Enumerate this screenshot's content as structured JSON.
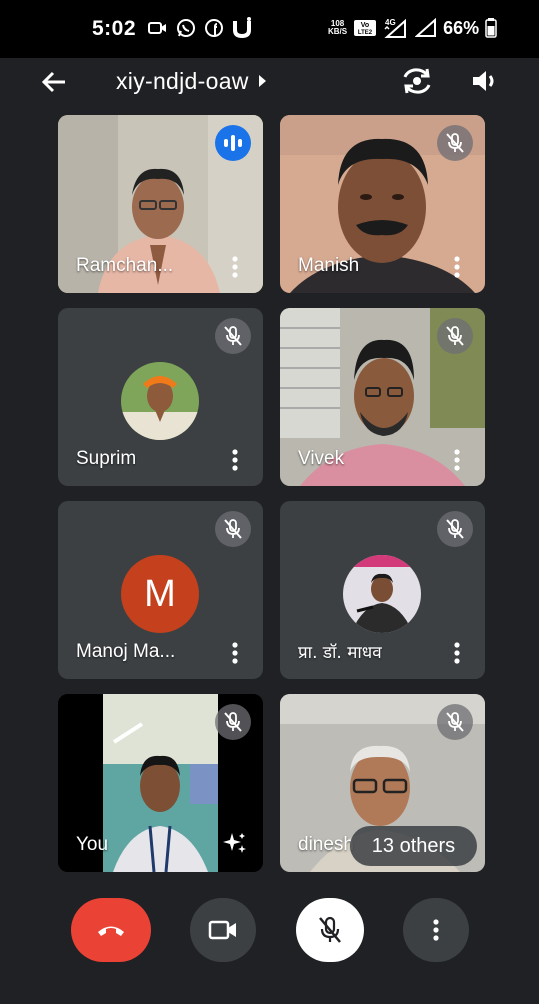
{
  "status_bar": {
    "time": "5:02",
    "network_speed_value": "108",
    "network_speed_unit": "KB/S",
    "volte_label": "Vo LTE 2",
    "signal_label": "4G",
    "battery": "66%"
  },
  "header": {
    "meeting_code": "xiy-ndjd-oaw"
  },
  "participants": [
    {
      "name": "Ramchan...",
      "state": "speaking"
    },
    {
      "name": "Manish",
      "state": "muted"
    },
    {
      "name": "Suprim",
      "state": "muted"
    },
    {
      "name": "Vivek",
      "state": "muted"
    },
    {
      "name": "Manoj Ma...",
      "state": "muted",
      "avatar_letter": "M"
    },
    {
      "name": "प्रा. डॉ. माधव",
      "state": "muted"
    },
    {
      "name": "You",
      "state": "muted"
    },
    {
      "name": "dinesh",
      "state": "muted"
    }
  ],
  "others_label": "13 others",
  "colors": {
    "background": "#202124",
    "tile": "#3c4043",
    "end_call": "#ea4335",
    "speaker_indicator": "#1a73e8",
    "avatar_m": "#c5401d"
  }
}
